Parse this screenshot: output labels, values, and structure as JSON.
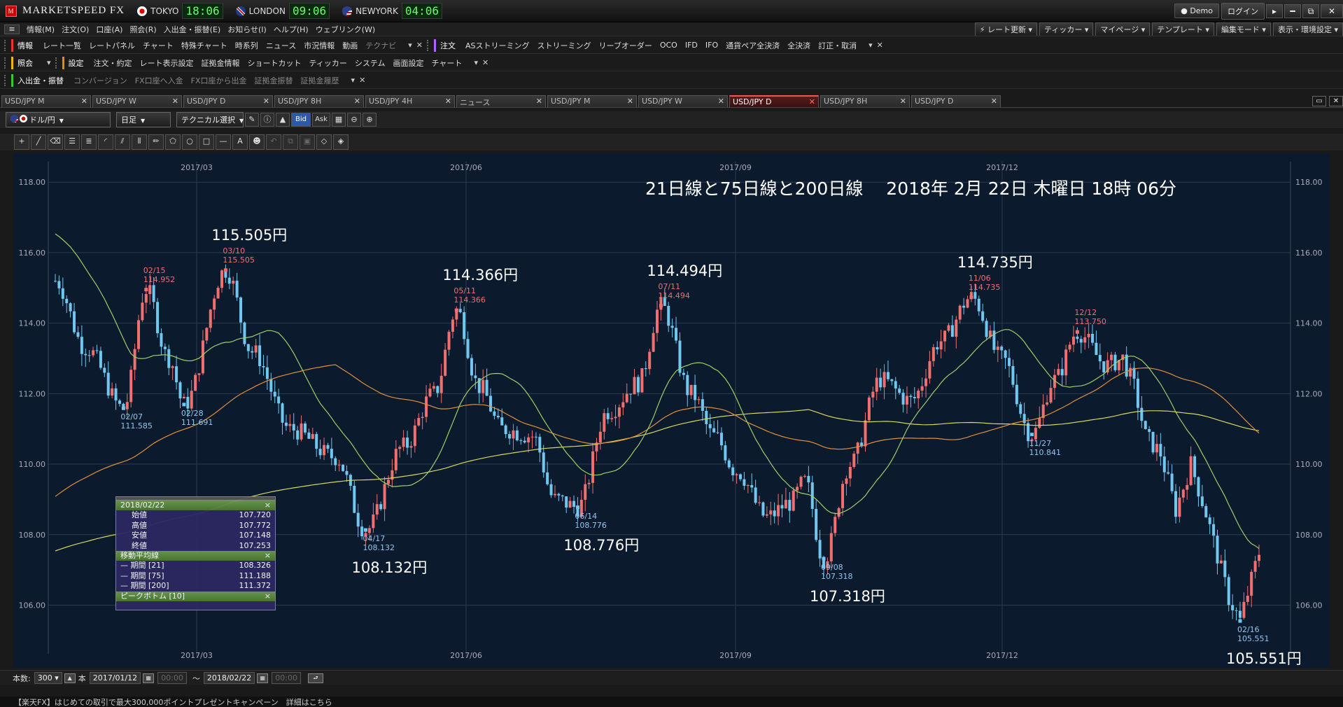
{
  "app": {
    "title": "MARKETSPEED FX",
    "logo_mark": "M"
  },
  "clocks": [
    {
      "city": "TOKYO",
      "time": "18:06"
    },
    {
      "city": "LONDON",
      "time": "09:06"
    },
    {
      "city": "NEWYORK",
      "time": "04:06"
    }
  ],
  "window": {
    "demo_label": "Demo",
    "login_label": "ログイン",
    "win_btns": [
      "▸",
      "━",
      "⧉",
      "✕"
    ]
  },
  "menu": {
    "items": [
      "情報(M)",
      "注文(O)",
      "口座(A)",
      "照会(R)",
      "入出金・振替(E)",
      "お知らせ(I)",
      "ヘルプ(H)",
      "ウェブリンク(W)"
    ],
    "right": [
      "レート更新",
      "ティッカー",
      "マイページ",
      "テンプレート",
      "編集モード",
      "表示・環境設定"
    ]
  },
  "toolbar1": {
    "hdr_info": "情報",
    "info_items": [
      "レート一覧",
      "レートパネル",
      "チャート",
      "特殊チャート",
      "時系列",
      "ニュース",
      "市況情報",
      "動画"
    ],
    "dim_item": "テクナビ",
    "hdr_order": "注文",
    "order_items": [
      "ASストリーミング",
      "ストリーミング",
      "リーブオーダー",
      "OCO",
      "IFD",
      "IFO",
      "通貨ペア全決済",
      "全決済",
      "訂正・取消"
    ]
  },
  "toolbar2": {
    "hdr_inquiry": "照会",
    "hdr_settings": "設定",
    "items": [
      "注文・約定",
      "レート表示設定",
      "証拠金情報",
      "ショートカット",
      "ティッカー",
      "システム",
      "画面設定",
      "チャート"
    ]
  },
  "toolbar3": {
    "hdr": "入出金・振替",
    "items": [
      "コンバージョン",
      "FX口座へ入金",
      "FX口座から出金",
      "証拠金振替",
      "証拠金履歴"
    ]
  },
  "tabs": [
    {
      "label": "USD/JPY M",
      "active": false
    },
    {
      "label": "USD/JPY W",
      "active": false
    },
    {
      "label": "USD/JPY D",
      "active": false
    },
    {
      "label": "USD/JPY 8H",
      "active": false
    },
    {
      "label": "USD/JPY 4H",
      "active": false
    },
    {
      "label": "ニュース",
      "active": false
    },
    {
      "label": "USD/JPY M",
      "active": false
    },
    {
      "label": "USD/JPY W",
      "active": false
    },
    {
      "label": "USD/JPY D",
      "active": true
    },
    {
      "label": "USD/JPY 8H",
      "active": false
    },
    {
      "label": "USD/JPY D",
      "active": false
    }
  ],
  "controls": {
    "pair": "ドル/円",
    "period": "日足",
    "technical": "テクニカル選択",
    "bid": "Bid",
    "ask": "Ask"
  },
  "drawtools": [
    "cursor-icon",
    "line-icon",
    "eraser-icon",
    "hlines-icon",
    "channel-icon",
    "fan-icon",
    "trend-icon",
    "vlines-icon",
    "pencil-icon",
    "polygon-icon",
    "circle-icon",
    "rect-icon",
    "hline-icon",
    "text-icon",
    "stamp-icon",
    "undo-icon",
    "copy-icon",
    "paste-icon",
    "erase-one-icon",
    "erase-all-icon"
  ],
  "chart_data": {
    "type": "candlestick",
    "title": "",
    "overlay_text": "21日線と75日線と200日線　 2018年 2月 22日 木曜日 18時 06分",
    "ylim": [
      104.5,
      118.6
    ],
    "y_ticks": [
      "118.00",
      "116.00",
      "114.00",
      "112.00",
      "110.00",
      "108.00",
      "106.00"
    ],
    "x_ticks": [
      "2017/03",
      "2017/06",
      "2017/09",
      "2017/12"
    ],
    "colors": {
      "up": "#f07070",
      "down": "#70c8f0",
      "ma21": "#9bd068",
      "ma75": "#e0903a",
      "ma200": "#d8d860",
      "bg": "#0c1a2e",
      "grid": "#2a3a50"
    },
    "peaks": [
      {
        "date": "02/15",
        "value": "114.952",
        "type": "high"
      },
      {
        "date": "03/10",
        "value": "115.505",
        "type": "high",
        "big": "115.505円"
      },
      {
        "date": "05/11",
        "value": "114.366",
        "type": "high",
        "big": "114.366円"
      },
      {
        "date": "07/11",
        "value": "114.494",
        "type": "high",
        "big": "114.494円"
      },
      {
        "date": "11/06",
        "value": "114.735",
        "type": "high",
        "big": "114.735円"
      },
      {
        "date": "12/12",
        "value": "113.750",
        "type": "high"
      },
      {
        "date": "02/07",
        "value": "111.585",
        "type": "low"
      },
      {
        "date": "02/28",
        "value": "111.691",
        "type": "low"
      },
      {
        "date": "04/17",
        "value": "108.132",
        "type": "low",
        "big": "108.132円"
      },
      {
        "date": "06/14",
        "value": "108.776",
        "type": "low",
        "big": "108.776円"
      },
      {
        "date": "09/08",
        "value": "107.318",
        "type": "low",
        "big": "107.318円"
      },
      {
        "date": "11/27",
        "value": "110.841",
        "type": "low"
      },
      {
        "date": "02/16",
        "value": "105.551",
        "type": "low",
        "big": "105.551円"
      }
    ],
    "ma_end": {
      "ma21": 108.326,
      "ma75": 111.188,
      "ma200": 111.372
    }
  },
  "infopanel": {
    "date": "2018/02/22",
    "close_x": "×",
    "rows": [
      {
        "k": "始値",
        "v": "107.720"
      },
      {
        "k": "高値",
        "v": "107.772"
      },
      {
        "k": "安値",
        "v": "107.148"
      },
      {
        "k": "終値",
        "v": "107.253"
      }
    ],
    "ma_hdr": "移動平均線",
    "ma": [
      {
        "k": "— 期間 [21]",
        "v": "108.326"
      },
      {
        "k": "— 期間 [75]",
        "v": "111.188"
      },
      {
        "k": "— 期間 [200]",
        "v": "111.372"
      }
    ],
    "pb_hdr": "ピークボトム [10]"
  },
  "range": {
    "count_label": "本数:",
    "count": "300",
    "unit": "本",
    "from": "2017/01/12",
    "from_time": "00:00",
    "tilde": "〜",
    "to": "2018/02/22",
    "to_time": "00:00"
  },
  "status": {
    "text": "【楽天FX】はじめての取引で最大300,000ポイントプレゼントキャンペーン　詳細はこちら"
  }
}
